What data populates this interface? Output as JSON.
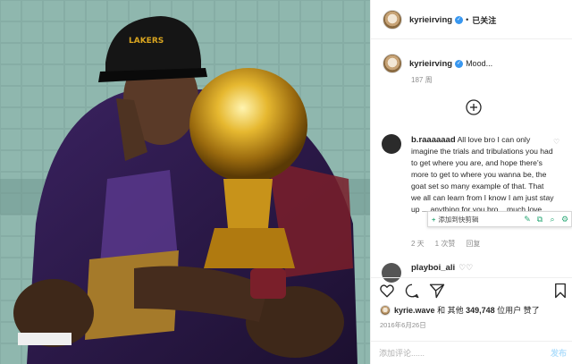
{
  "header": {
    "username": "kyrieirving",
    "follow_status": "已关注"
  },
  "caption": {
    "username": "kyrieirving",
    "text": "Mood...",
    "age": "187 周"
  },
  "comment": {
    "username": "b.raaaaaad",
    "text": "All love bro I can only imagine the trials and tribulations you had to get where you are, and hope there's more to get to where you wanna be, the goat set so many example of that. That we all can learn from I know I am just stay up ... anything for you bro... much love",
    "age": "2 天",
    "likes": "1 次赞",
    "reply": "回复"
  },
  "comment2": {
    "username": "playboi_ali"
  },
  "toolbar": {
    "add_label": "添加到快剪辑"
  },
  "likes": {
    "liker": "kyrie.wave",
    "rest_prefix": "和 其他",
    "count": "349,748",
    "rest_suffix": "位用户 赞了"
  },
  "date": "2016年6月26日",
  "add_comment": {
    "placeholder": "添加评论......",
    "post_label": "发布"
  },
  "colors": {
    "accent": "#3897f0",
    "trophy_gold": "#d9a520",
    "lakers_purple": "#4b2a7b"
  }
}
